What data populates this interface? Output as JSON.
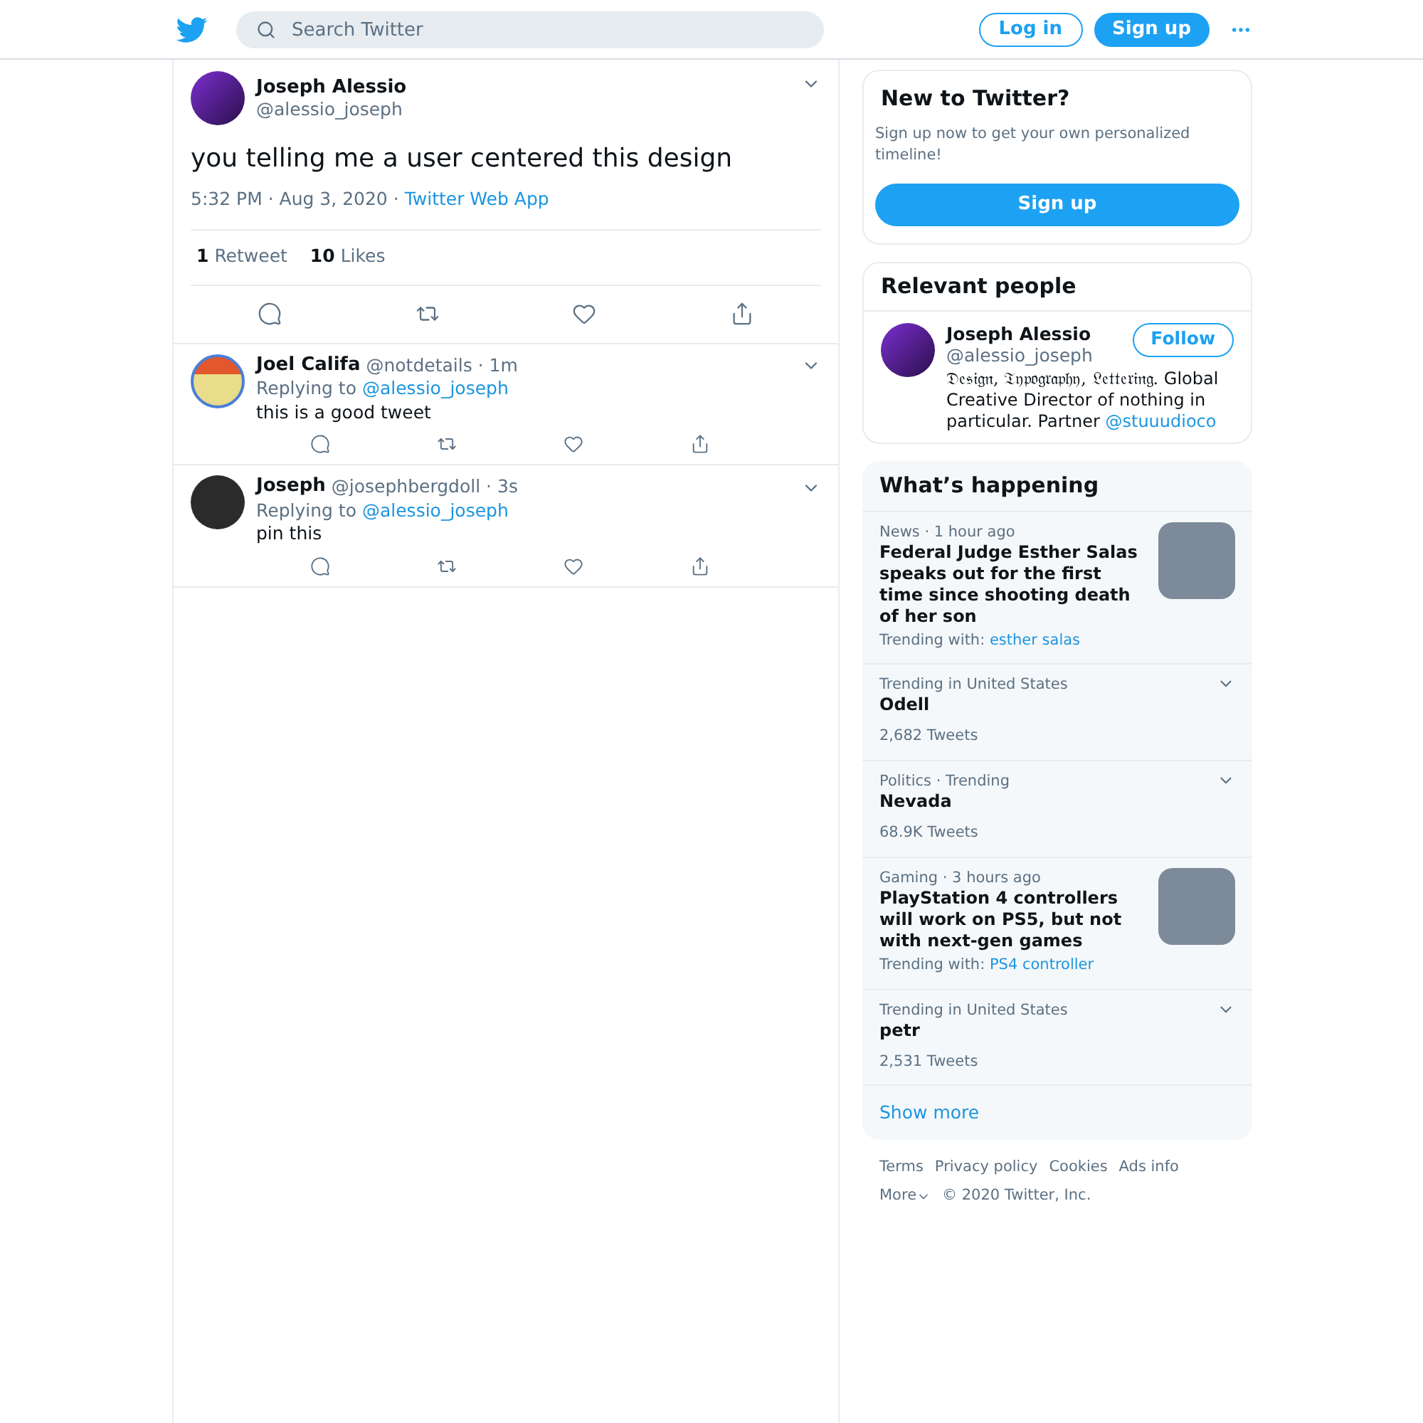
{
  "header": {
    "search": {
      "placeholder": "Search Twitter"
    },
    "buttons": [
      {
        "label": "Log in",
        "kind": "outline"
      },
      {
        "label": "Sign up",
        "kind": "filled"
      }
    ]
  },
  "tweet": {
    "name": "Joseph Alessio",
    "handle": "@alessio_joseph",
    "text": "you telling me a user centered this design",
    "time": "5:32 PM · Aug 3, 2020 · ",
    "source": "Twitter Web App",
    "stats": [
      {
        "count": "1",
        "label": "Retweet"
      },
      {
        "count": "10",
        "label": "Likes"
      }
    ]
  },
  "replies": [
    {
      "name": "Joel Califa",
      "handle": "@notdetails · 1m",
      "replying_label": "Replying to",
      "replying_to": "@alessio_joseph",
      "text": "this is a good tweet",
      "avatar_ring": true
    },
    {
      "name": "Joseph",
      "handle": "@josephbergdoll · 3s",
      "replying_label": "Replying to",
      "replying_to": "@alessio_joseph",
      "text": "pin this",
      "avatar_ring": false
    }
  ],
  "new_to_twitter": {
    "title": "New to Twitter?",
    "text": "Sign up now to get your own personalized timeline!",
    "button": "Sign up"
  },
  "relevant_people": {
    "title": "Relevant people",
    "person": {
      "name": "Joseph Alessio",
      "handle": "@alessio_joseph",
      "follow": "Follow",
      "bio_fancy": "𝔇𝔢𝔰𝔦𝔤𝔫, 𝔗𝔶𝔭𝔬𝔤𝔯𝔞𝔭𝔥𝔶, 𝔏𝔢𝔱𝔱𝔢𝔯𝔦𝔫𝔤.",
      "bio_text": " Global Creative Director of nothing in particular. Partner ",
      "bio_link": "@stuuudioco"
    }
  },
  "whats_happening": {
    "title": "What’s happening",
    "items": [
      {
        "kind": "news",
        "meta": "News · 1 hour ago",
        "title": "Federal Judge Esther Salas speaks out for the first time since shooting death of her son",
        "trending_label": "Trending with: ",
        "trending_link": "esther salas"
      },
      {
        "kind": "trend",
        "meta": "Trending in United States",
        "title": "Odell",
        "count": "2,682 Tweets"
      },
      {
        "kind": "trend",
        "meta": "Politics · Trending",
        "title": "Nevada",
        "count": "68.9K Tweets"
      },
      {
        "kind": "news",
        "meta": "Gaming · 3 hours ago",
        "title": "PlayStation 4 controllers will work on PS5, but not with next-gen games",
        "trending_label": "Trending with: ",
        "trending_link": "PS4 controller"
      },
      {
        "kind": "trend",
        "meta": "Trending in United States",
        "title": "petr",
        "count": "2,531 Tweets"
      }
    ],
    "show_more": "Show more"
  },
  "footer": {
    "links": [
      "Terms",
      "Privacy policy",
      "Cookies",
      "Ads info"
    ],
    "more": "More",
    "copyright": "© 2020 Twitter, Inc."
  }
}
